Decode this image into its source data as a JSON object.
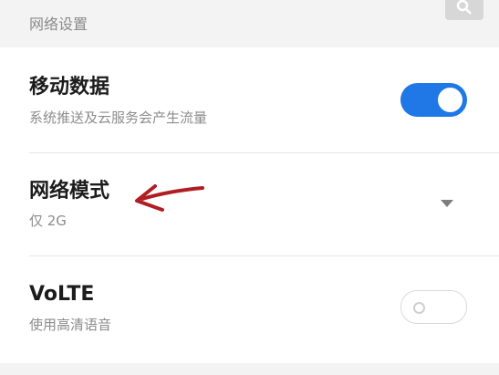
{
  "section": {
    "title": "网络设置"
  },
  "mobile_data": {
    "title": "移动数据",
    "subtitle": "系统推送及云服务会产生流量",
    "enabled": true
  },
  "network_mode": {
    "title": "网络模式",
    "value": "仅 2G"
  },
  "volte": {
    "title": "VoLTE",
    "subtitle": "使用高清语音",
    "enabled": false
  },
  "icons": {
    "corner": "search-icon",
    "dropdown": "triangle-down-icon",
    "annotation": "red-arrow-icon"
  },
  "colors": {
    "accent": "#1f78e6",
    "annotation": "#b01e24"
  }
}
